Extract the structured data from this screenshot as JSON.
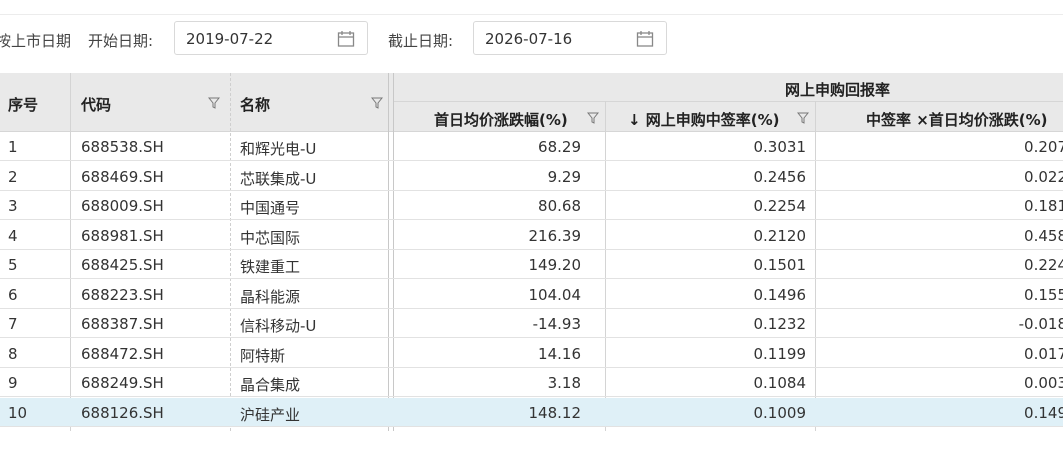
{
  "filters": {
    "market_label": "按上市日期",
    "start_label": "开始日期:",
    "start_date": "2019-07-22",
    "end_label": "截止日期:",
    "end_date": "2026-07-16"
  },
  "table": {
    "group_header": "网上申购回报率",
    "headers": {
      "index": "序号",
      "code": "代码",
      "name": "名称",
      "first_day_change": "首日均价涨跌幅(%)",
      "win_rate": "↓ 网上申购中签率(%)",
      "return": "中签率 ×首日均价涨跌(%)"
    },
    "rows": [
      {
        "index": "1",
        "code": "688538.SH",
        "name": "和辉光电-U",
        "first_day_change": "68.29",
        "win_rate": "0.3031",
        "return": "0.207"
      },
      {
        "index": "2",
        "code": "688469.SH",
        "name": "芯联集成-U",
        "first_day_change": "9.29",
        "win_rate": "0.2456",
        "return": "0.022"
      },
      {
        "index": "3",
        "code": "688009.SH",
        "name": "中国通号",
        "first_day_change": "80.68",
        "win_rate": "0.2254",
        "return": "0.181"
      },
      {
        "index": "4",
        "code": "688981.SH",
        "name": "中芯国际",
        "first_day_change": "216.39",
        "win_rate": "0.2120",
        "return": "0.458"
      },
      {
        "index": "5",
        "code": "688425.SH",
        "name": "铁建重工",
        "first_day_change": "149.20",
        "win_rate": "0.1501",
        "return": "0.224"
      },
      {
        "index": "6",
        "code": "688223.SH",
        "name": "晶科能源",
        "first_day_change": "104.04",
        "win_rate": "0.1496",
        "return": "0.155"
      },
      {
        "index": "7",
        "code": "688387.SH",
        "name": "信科移动-U",
        "first_day_change": "-14.93",
        "win_rate": "0.1232",
        "return": "-0.018"
      },
      {
        "index": "8",
        "code": "688472.SH",
        "name": "阿特斯",
        "first_day_change": "14.16",
        "win_rate": "0.1199",
        "return": "0.017"
      },
      {
        "index": "9",
        "code": "688249.SH",
        "name": "晶合集成",
        "first_day_change": "3.18",
        "win_rate": "0.1084",
        "return": "0.003"
      },
      {
        "index": "10",
        "code": "688126.SH",
        "name": "沪硅产业",
        "first_day_change": "148.12",
        "win_rate": "0.1009",
        "return": "0.149"
      }
    ],
    "selected_row": 10
  },
  "icons": {
    "calendar": "calendar-icon",
    "filter": "filter-funnel-icon"
  },
  "colors": {
    "header_bg": "#e9e9e9",
    "selected_row_bg": "#dff0f7"
  }
}
